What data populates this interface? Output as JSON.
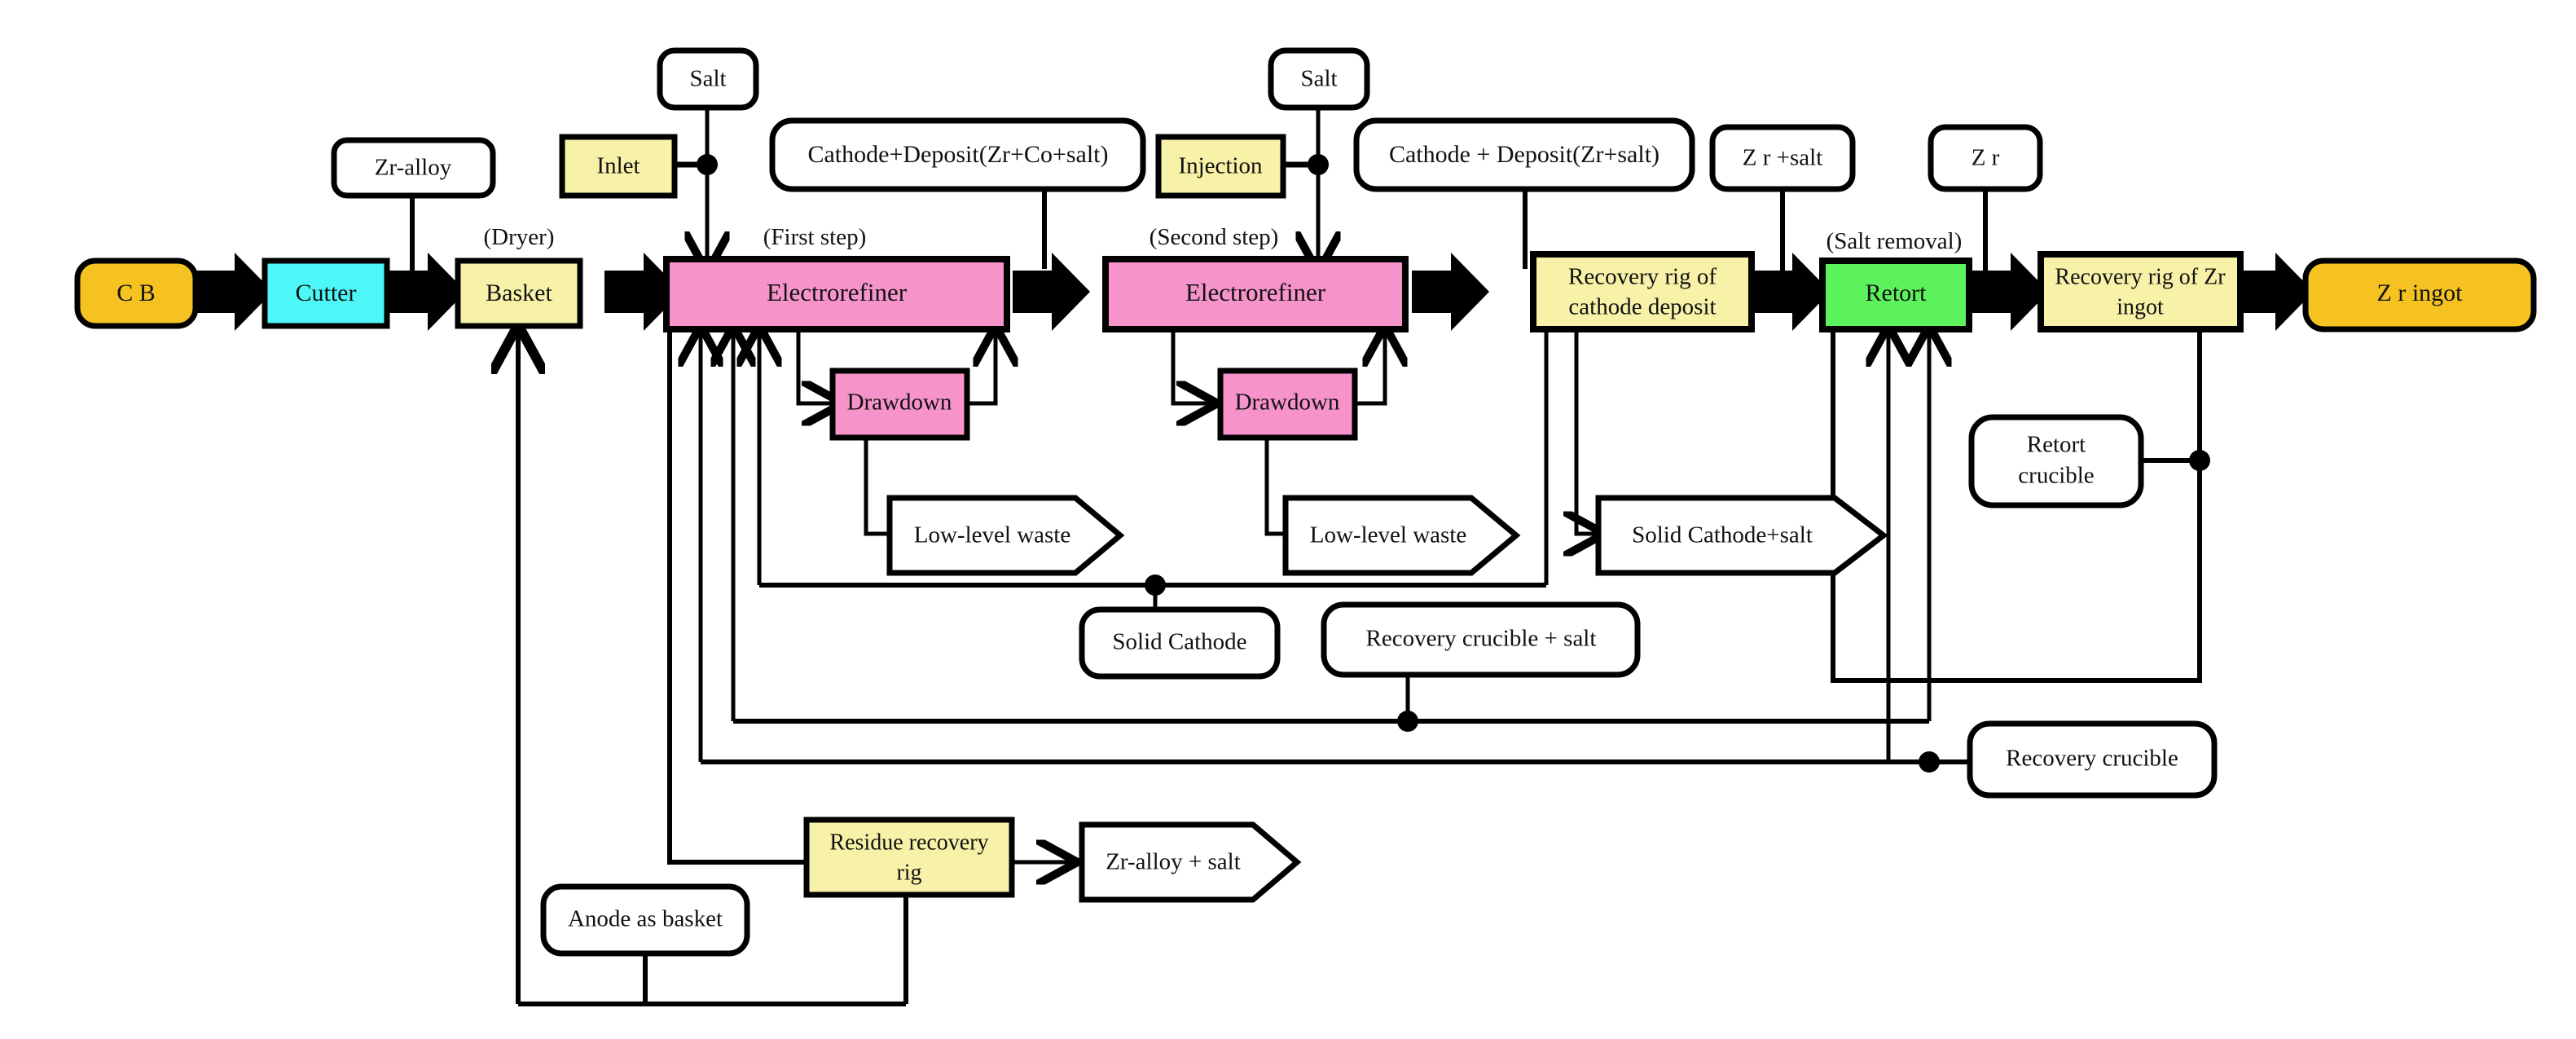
{
  "title": "Zr recovery electrorefining process flow diagram",
  "colors": {
    "gold": "#F5C222",
    "cyan": "#4DF7F7",
    "yellow": "#F7F2A8",
    "pink": "#F793CB",
    "green": "#5CF25C",
    "white": "#FFFFFF",
    "stroke": "#000000"
  },
  "nodes": {
    "cb": {
      "label": "C B"
    },
    "cutter": {
      "label": "Cutter"
    },
    "basket": {
      "label": "Basket"
    },
    "electrorefiner1": {
      "label": "Electrorefiner"
    },
    "electrorefiner2": {
      "label": "Electrorefiner"
    },
    "recovery_rig_cathode": {
      "label_line1": "Recovery rig of",
      "label_line2": "cathode deposit"
    },
    "retort": {
      "label": "Retort"
    },
    "recovery_rig_ingot": {
      "label_line1": "Recovery rig of Zr",
      "label_line2": "ingot"
    },
    "zr_ingot": {
      "label": "Z r  ingot"
    },
    "inlet": {
      "label": "Inlet"
    },
    "injection": {
      "label": "Injection"
    },
    "drawdown1": {
      "label": "Drawdown"
    },
    "drawdown2": {
      "label": "Drawdown"
    },
    "residue_recovery_rig": {
      "label_line1": "Residue recovery",
      "label_line2": "rig"
    },
    "zr_alloy": {
      "label": "Zr-alloy"
    },
    "salt1": {
      "label": "Salt"
    },
    "salt2": {
      "label": "Salt"
    },
    "cathode_deposit1": {
      "label": "Cathode+Deposit(Zr+Co+salt)"
    },
    "cathode_deposit2": {
      "label": "Cathode + Deposit(Zr+salt)"
    },
    "zr_plus_salt": {
      "label": "Z r +salt"
    },
    "zr": {
      "label": "Z r"
    },
    "retort_crucible": {
      "label_line1": "Retort",
      "label_line2": "crucible"
    },
    "solid_cathode": {
      "label": "Solid Cathode"
    },
    "recovery_crucible_salt": {
      "label": "Recovery crucible + salt"
    },
    "recovery_crucible": {
      "label": "Recovery crucible"
    },
    "anode_as_basket": {
      "label": "Anode as basket"
    },
    "low_level_waste1": {
      "label": "Low-level waste"
    },
    "low_level_waste2": {
      "label": "Low-level waste"
    },
    "solid_cathode_salt": {
      "label": "Solid Cathode+salt"
    },
    "zr_alloy_salt": {
      "label": "Zr-alloy + salt"
    }
  },
  "captions": {
    "dryer": "(Dryer)",
    "first_step": "(First step)",
    "second_step": "(Second step)",
    "salt_removal": "(Salt removal)"
  }
}
